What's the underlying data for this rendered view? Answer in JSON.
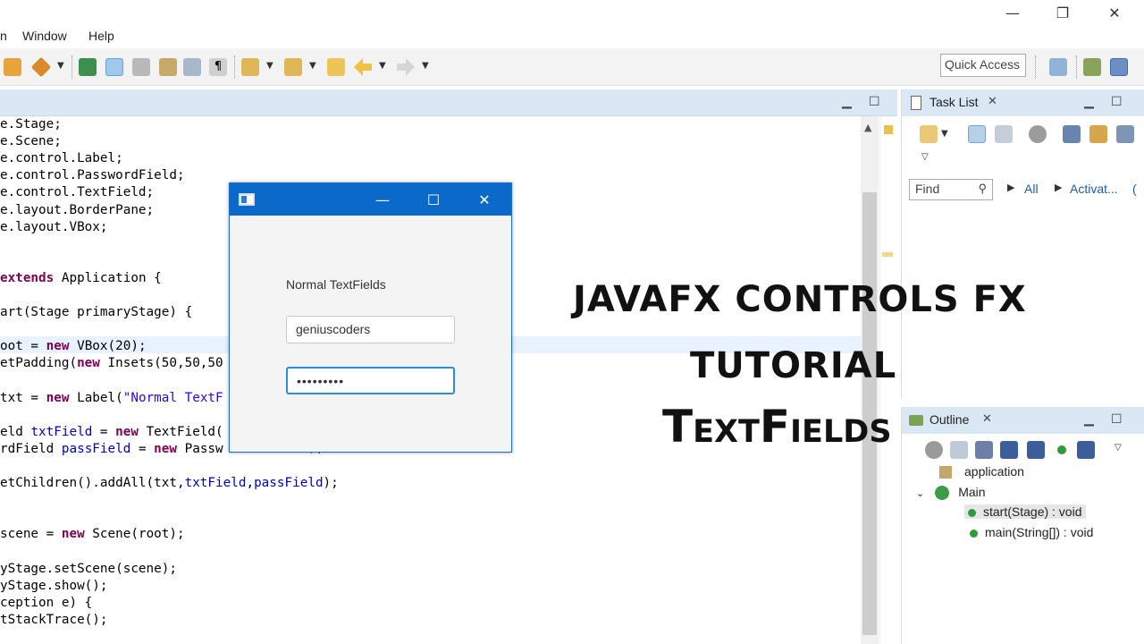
{
  "window_controls": {
    "minimize": "—",
    "maximize": "❐",
    "close": "✕"
  },
  "menu": {
    "partial_item": "n",
    "items": [
      "Window",
      "Help"
    ]
  },
  "toolbar": {
    "quick_access_label": "Quick Access"
  },
  "editor": {
    "lines": [
      "e.Stage;",
      "e.Scene;",
      "e.control.Label;",
      "e.control.PasswordField;",
      "e.control.TextField;",
      "e.layout.BorderPane;",
      "e.layout.VBox;",
      "",
      "",
      "extends Application {",
      "",
      "art(Stage primaryStage) {",
      "",
      "oot = new VBox(20);",
      "etPadding(new Insets(50,50,50",
      "",
      "txt = new Label(\"Normal TextF",
      "",
      "eld txtField = new TextField(",
      "rdField passField = new Passw",
      "",
      "etChildren().addAll(txt,txtField,passField);",
      "",
      "",
      "scene = new Scene(root);",
      "",
      "yStage.setScene(scene);",
      "yStage.show();",
      "ception e) {",
      "tStackTrace();"
    ],
    "tail_fragment": ");"
  },
  "task_list": {
    "title": "Task List",
    "find_placeholder": "Find",
    "filter_all": "All",
    "filter_activate": "Activat...",
    "paren": "("
  },
  "outline": {
    "title": "Outline",
    "items": [
      {
        "label": "application",
        "kind": "package"
      },
      {
        "label": "Main",
        "kind": "class"
      },
      {
        "label": "start(Stage) : void",
        "kind": "method",
        "selected": true
      },
      {
        "label": "main(String[]) : void",
        "kind": "static-method"
      }
    ]
  },
  "fx_window": {
    "label": "Normal TextFields",
    "text_value": "geniuscoders",
    "password_mask": "•••••••••",
    "controls": {
      "minimize": "—",
      "maximize": "☐",
      "close": "✕"
    }
  },
  "overlay": {
    "line1": "JAVAFX CONTROLS FX",
    "line2": "TUTORIAL",
    "line3": "TextFields"
  },
  "colors": {
    "editor_header": "#dae8f5",
    "fx_titlebar": "#0b6ac9",
    "keyword": "#7f0055",
    "string": "#2a00ff",
    "field": "#0000c0",
    "link": "#1f5ba8"
  }
}
